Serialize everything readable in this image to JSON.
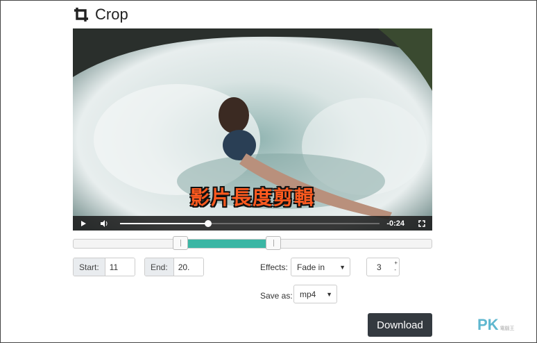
{
  "header": {
    "title": "Crop",
    "icon": "crop-icon"
  },
  "video": {
    "subtitle": "影片長度剪輯",
    "time_remaining": "-0:24",
    "progress_percent": 34,
    "play_icon": "play-icon",
    "volume_icon": "volume-icon",
    "fullscreen_icon": "fullscreen-icon"
  },
  "trim": {
    "range_start_percent": 30,
    "range_end_percent": 56,
    "accent": "#3bb6a4"
  },
  "start": {
    "label": "Start:",
    "value": "11"
  },
  "end": {
    "label": "End:",
    "value": "20."
  },
  "effects": {
    "label": "Effects:",
    "selected": "Fade in",
    "duration": "3"
  },
  "save": {
    "label": "Save as:",
    "selected": "mp4"
  },
  "download_label": "Download",
  "watermark": {
    "text": "PK",
    "small": "電腦王"
  }
}
